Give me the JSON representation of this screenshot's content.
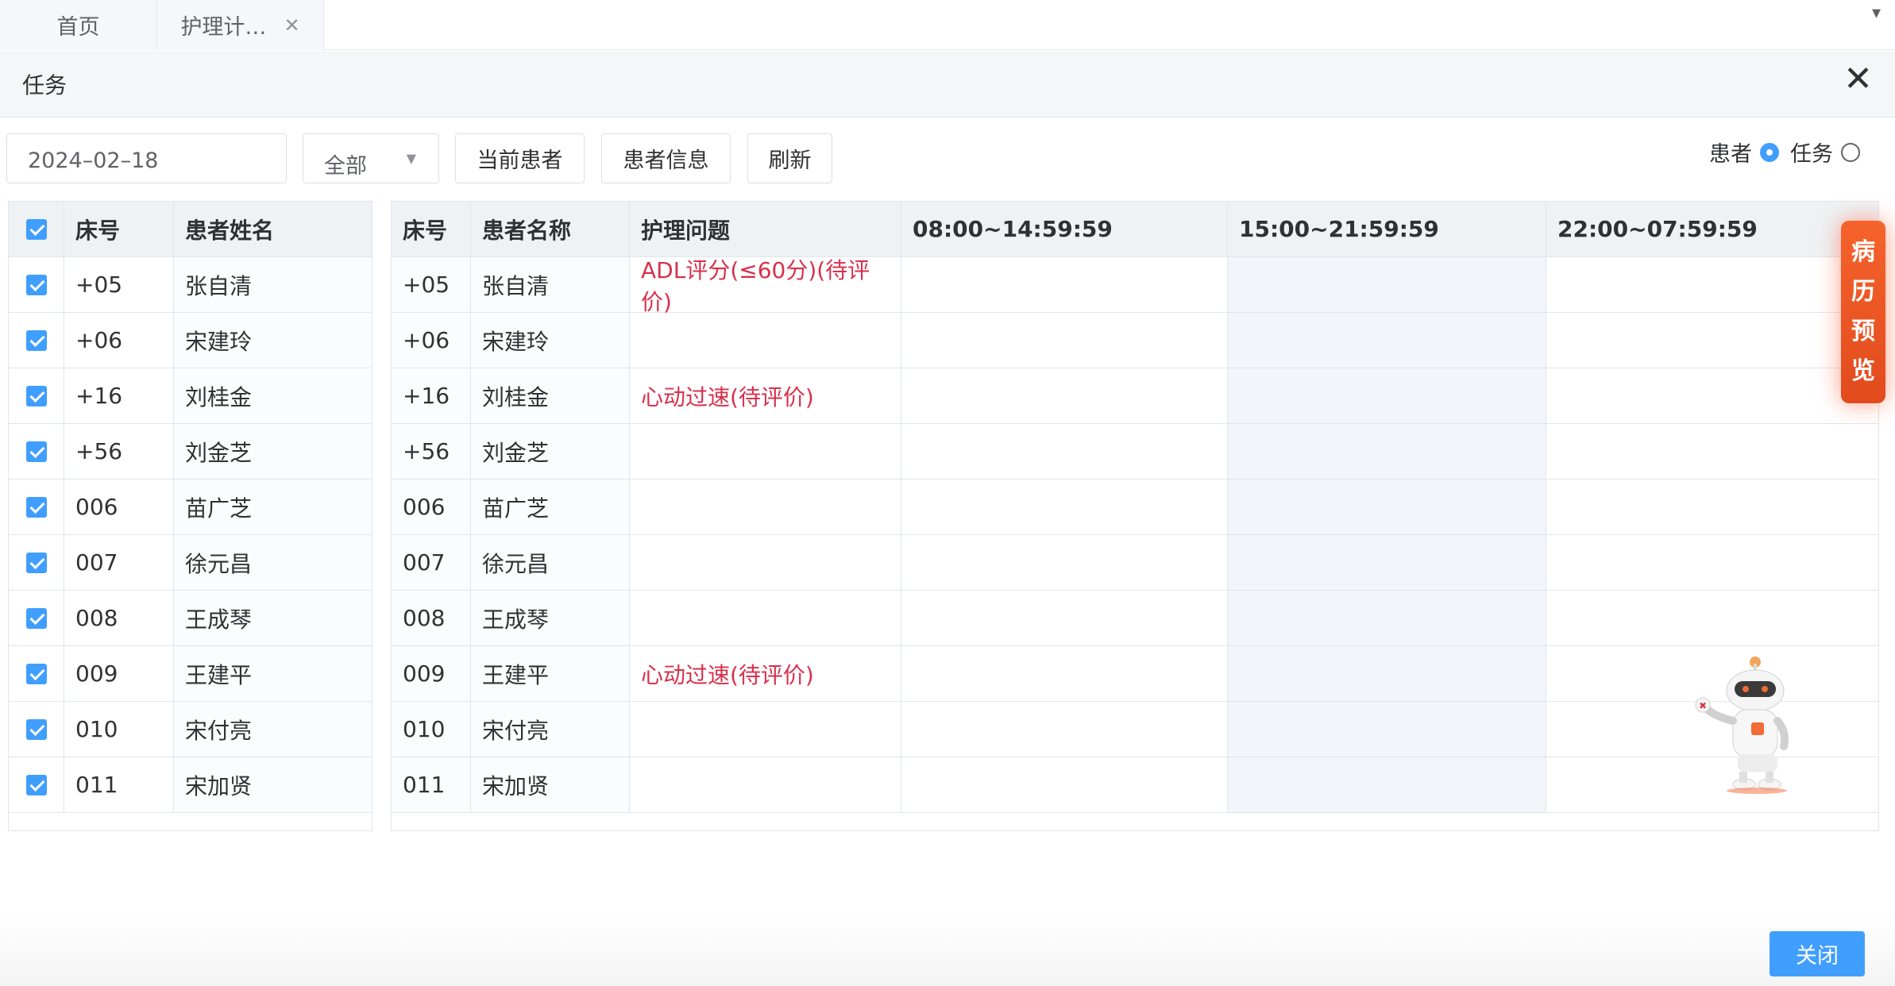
{
  "tabs": [
    {
      "label": "首页"
    },
    {
      "label": "护理计…"
    }
  ],
  "dialog": {
    "title": "任务"
  },
  "toolbar": {
    "date": "2024–02–18",
    "filter": "全部",
    "btn_current": "当前患者",
    "btn_info": "患者信息",
    "btn_refresh": "刷新",
    "radio_patient": "患者",
    "radio_task": "任务"
  },
  "left_table": {
    "headers": [
      "床号",
      "患者姓名"
    ]
  },
  "right_table": {
    "headers": [
      "床号",
      "患者名称",
      "护理问题",
      "08:00~14:59:59",
      "15:00~21:59:59",
      "22:00~07:59:59"
    ]
  },
  "rows": [
    {
      "bed": "+05",
      "name": "张自清",
      "problem": "ADL评分(≤60分)(待评价)"
    },
    {
      "bed": "+06",
      "name": "宋建玲",
      "problem": ""
    },
    {
      "bed": "+16",
      "name": "刘桂金",
      "problem": "心动过速(待评价)"
    },
    {
      "bed": "+56",
      "name": "刘金芝",
      "problem": ""
    },
    {
      "bed": "006",
      "name": "苗广芝",
      "problem": ""
    },
    {
      "bed": "007",
      "name": "徐元昌",
      "problem": ""
    },
    {
      "bed": "008",
      "name": "王成琴",
      "problem": ""
    },
    {
      "bed": "009",
      "name": "王建平",
      "problem": "心动过速(待评价)"
    },
    {
      "bed": "010",
      "name": "宋付亮",
      "problem": ""
    },
    {
      "bed": "011",
      "name": "宋加贤",
      "problem": ""
    }
  ],
  "side_badge": [
    "病",
    "历",
    "预",
    "览"
  ],
  "footer": {
    "close": "关闭"
  },
  "colors": {
    "primary": "#409eff",
    "warning": "#d9304b",
    "badge": "#e24b1d"
  }
}
